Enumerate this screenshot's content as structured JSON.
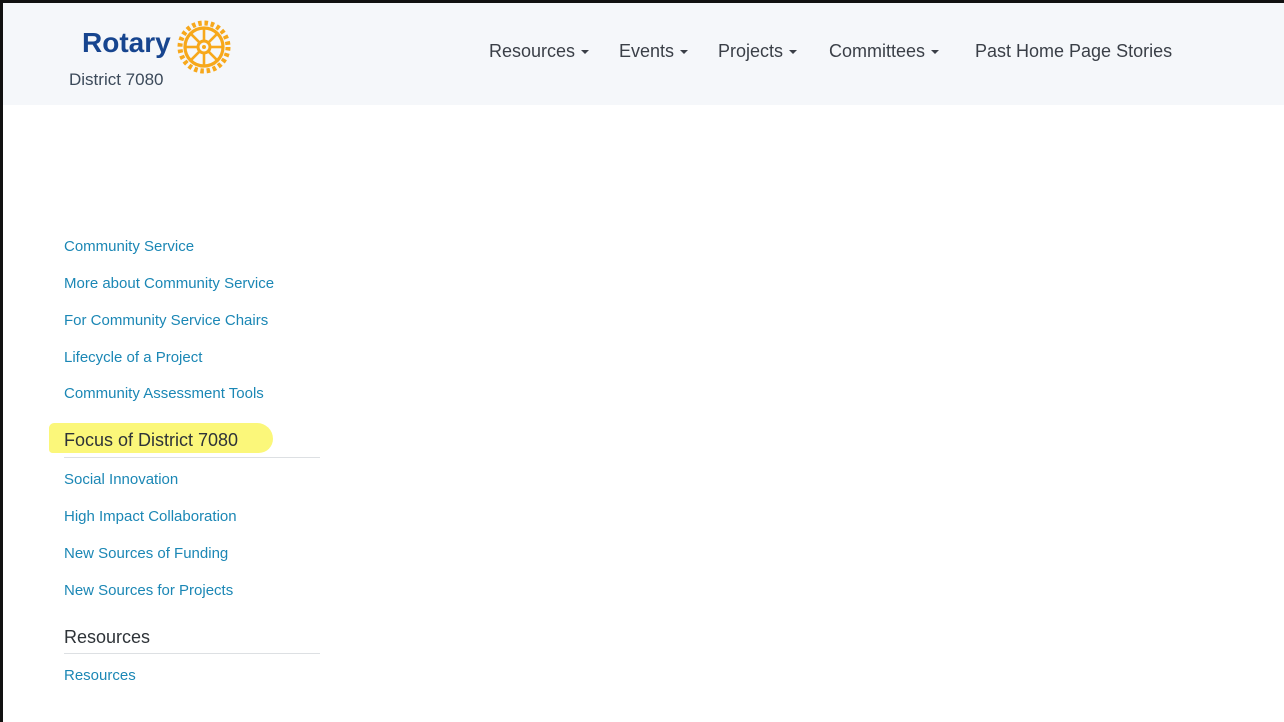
{
  "brand": {
    "name": "Rotary",
    "district": "District 7080",
    "wheel_color": "#f7a81b",
    "brand_color": "#17458f"
  },
  "nav": {
    "items": [
      {
        "label": "Resources",
        "dropdown": true
      },
      {
        "label": "Events",
        "dropdown": true
      },
      {
        "label": "Projects",
        "dropdown": true
      },
      {
        "label": "Committees",
        "dropdown": true
      },
      {
        "label": "Past Home Page Stories",
        "dropdown": false
      }
    ]
  },
  "sidebar": {
    "community_links": [
      "Community Service",
      "More about Community Service",
      "For Community Service Chairs",
      "Lifecycle of a Project",
      "Community Assessment Tools"
    ],
    "focus_heading": "Focus of District 7080",
    "focus_links": [
      "Social Innovation",
      "High Impact Collaboration",
      "New Sources of Funding",
      "New Sources for Projects"
    ],
    "resources_heading": "Resources",
    "resources_links": [
      "Resources"
    ]
  },
  "colors": {
    "link": "#1b87b5",
    "highlight": "#fbf77a",
    "header_bg": "#f5f7fa"
  }
}
